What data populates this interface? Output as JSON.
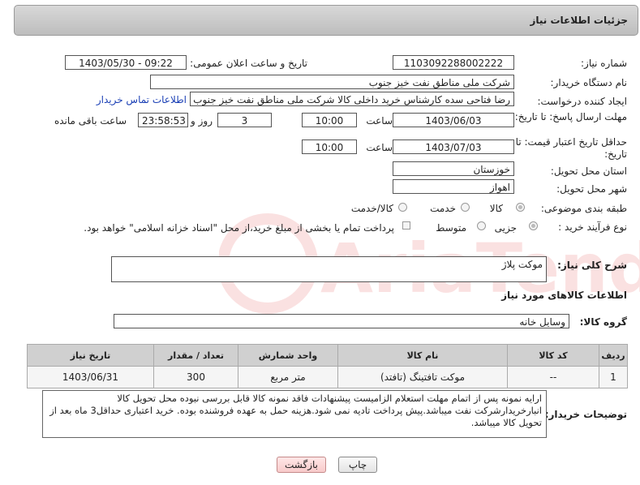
{
  "page_title": "جزئیات اطلاعات نیاز",
  "fields": {
    "need_number_label": "شماره نیاز:",
    "need_number": "1103092288002222",
    "announce_label": "تاریخ و ساعت اعلان عمومی:",
    "announce_value": "1403/05/30 - 09:22",
    "buyer_org_label": "نام دستگاه خریدار:",
    "buyer_org": "شرکت ملی مناطق نفت خیز جنوب",
    "creator_label": "ایجاد کننده درخواست:",
    "creator": "رضا فتاحی سده  کارشناس خرید داخلی کالا  شرکت ملی مناطق نفت خیز جنوب",
    "contact_link": "اطلاعات تماس خریدار",
    "reply_deadline_label": "مهلت ارسال پاسخ: تا تاریخ:",
    "reply_date": "1403/06/03",
    "time_label": "ساعت",
    "reply_time": "10:00",
    "days_value": "3",
    "days_label": "روز و",
    "remaining_time": "23:58:53",
    "remaining_label": "ساعت باقی مانده",
    "price_validity_label": "حداقل تاریخ اعتبار قیمت: تا تاریخ:",
    "price_date": "1403/07/03",
    "price_time": "10:00",
    "province_label": "استان محل تحویل:",
    "province": "خوزستان",
    "city_label": "شهر محل تحویل:",
    "city": "اهواز",
    "category_label": "طبقه بندی موضوعی:",
    "category_options": [
      "کالا",
      "خدمت",
      "کالا/خدمت"
    ],
    "process_label": "نوع فرآیند خرید :",
    "process_options": [
      "جزیی",
      "متوسط"
    ],
    "payment_note": "پرداخت تمام یا بخشی از مبلغ خرید،از محل \"اسناد خزانه اسلامی\" خواهد بود."
  },
  "summary": {
    "label": "شرح کلی نیاز:",
    "value": "موکت پلاژ"
  },
  "goods_info_title": "اطلاعات کالاهای مورد نیاز",
  "goods_group": {
    "label": "گروه کالا:",
    "value": "وسایل خانه"
  },
  "table": {
    "headers": [
      "ردیف",
      "کد کالا",
      "نام کالا",
      "واحد شمارش",
      "تعداد / مقدار",
      "تاریخ نیاز"
    ],
    "rows": [
      [
        "1",
        "--",
        "موکت تافتینگ (تافتد)",
        "متر مربع",
        "300",
        "1403/06/31"
      ]
    ]
  },
  "buyer_notes": {
    "label": "توضیحات خریدار:",
    "text": "ارایه نمونه پس از اتمام مهلت استعلام الزامیست پیشنهادات فاقد نمونه کالا قابل بررسی نبوده محل تحویل کالا انبارخریدارشرکت نفت میباشد.پیش پرداخت تادیه نمی شود.هزینه حمل به عهده فروشنده بوده. خرید اعتباری حداقل3 ماه بعد از تحویل کالا میباشد."
  },
  "buttons": {
    "print": "چاپ",
    "back": "بازگشت"
  },
  "watermark_text": "AriaTender.net",
  "colors": {
    "link": "#1a3fb5",
    "header_bg": "#d0d0d0",
    "back_button": "#f8caca"
  }
}
